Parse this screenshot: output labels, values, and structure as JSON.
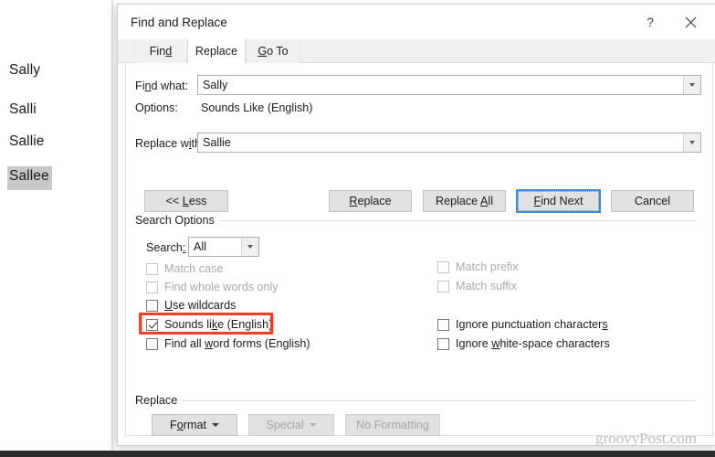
{
  "document": {
    "lines": [
      {
        "text": "Sally",
        "selected": false
      },
      {
        "text": "Salli",
        "selected": false
      },
      {
        "text": "Sallie",
        "selected": false
      },
      {
        "text": "Sallee",
        "selected": true
      }
    ]
  },
  "dialog": {
    "title": "Find and Replace",
    "help_icon": "question-mark-icon",
    "close_icon": "close-icon",
    "tabs": [
      {
        "label": "Find",
        "active": false
      },
      {
        "label": "Replace",
        "active": true
      },
      {
        "label": "Go To",
        "active": false
      }
    ],
    "fields": {
      "find_label": "Find what:",
      "find_value": "Sally",
      "options_label": "Options:",
      "options_value": "Sounds Like (English)",
      "replace_label": "Replace with:",
      "replace_value": "Sallie"
    },
    "buttons": {
      "less": "<< Less",
      "replace": "Replace",
      "replace_all": "Replace All",
      "find_next": "Find Next",
      "cancel": "Cancel"
    },
    "search_options": {
      "group_label": "Search Options",
      "search_label": "Search:",
      "search_value": "All",
      "left_checks": [
        {
          "label": "Match case",
          "checked": false,
          "disabled": true
        },
        {
          "label": "Find whole words only",
          "checked": false,
          "disabled": true
        },
        {
          "label": "Use wildcards",
          "checked": false,
          "disabled": false
        },
        {
          "label": "Sounds like (English)",
          "checked": true,
          "disabled": false
        },
        {
          "label": "Find all word forms (English)",
          "checked": false,
          "disabled": false
        }
      ],
      "right_checks": [
        {
          "label": "Match prefix",
          "checked": false,
          "disabled": true
        },
        {
          "label": "Match suffix",
          "checked": false,
          "disabled": true
        },
        {
          "label": "Ignore punctuation characters",
          "checked": false,
          "disabled": false
        },
        {
          "label": "Ignore white-space characters",
          "checked": false,
          "disabled": false
        }
      ]
    },
    "replace_section": {
      "group_label": "Replace",
      "format_button": "Format",
      "special_button": "Special",
      "no_formatting_button": "No Formatting"
    }
  },
  "watermark": "groovyPost.com",
  "colors": {
    "highlight_box": "#ef3e2a",
    "focus_border": "#3a8ddd",
    "selection": "#c8c8c8",
    "dialog_bg": "#ffffff",
    "tab_strip": "#f0f0f0",
    "button_face": "#e1e1e1"
  }
}
